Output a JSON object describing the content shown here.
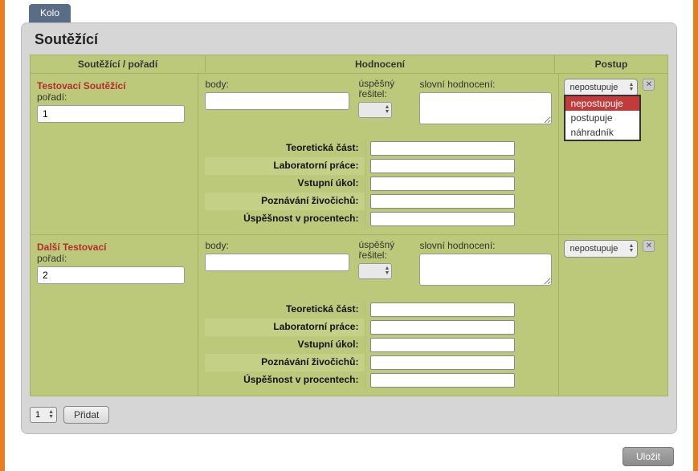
{
  "tab": {
    "label": "Kolo"
  },
  "panel": {
    "title": "Soutěžící"
  },
  "headers": {
    "left": "Soutěžící / pořadí",
    "mid": "Hodnocení",
    "right": "Postup"
  },
  "labels": {
    "poradi": "pořadí:",
    "body": "body:",
    "uspesny": "úspěšný řešitel:",
    "slovni": "slovní hodnocení:"
  },
  "sub_labels": [
    "Teoretická část:",
    "Laboratorní práce:",
    "Vstupní úkol:",
    "Poznávání živočichů:",
    "Úspěšnost v procentech:"
  ],
  "postup_options": [
    "nepostupuje",
    "postupuje",
    "náhradník"
  ],
  "rows": [
    {
      "name": "Testovací Soutěžící",
      "poradi": "1",
      "body": "",
      "slovni": "",
      "sub": [
        "",
        "",
        "",
        "",
        ""
      ],
      "postup": "nepostupuje",
      "dropdown_open": true
    },
    {
      "name": "Další Testovací",
      "poradi": "2",
      "body": "",
      "slovni": "",
      "sub": [
        "",
        "",
        "",
        "",
        ""
      ],
      "postup": "nepostupuje",
      "dropdown_open": false
    }
  ],
  "footer": {
    "add_count": "1",
    "add_label": "Přidat"
  },
  "save": {
    "label": "Uložit"
  }
}
